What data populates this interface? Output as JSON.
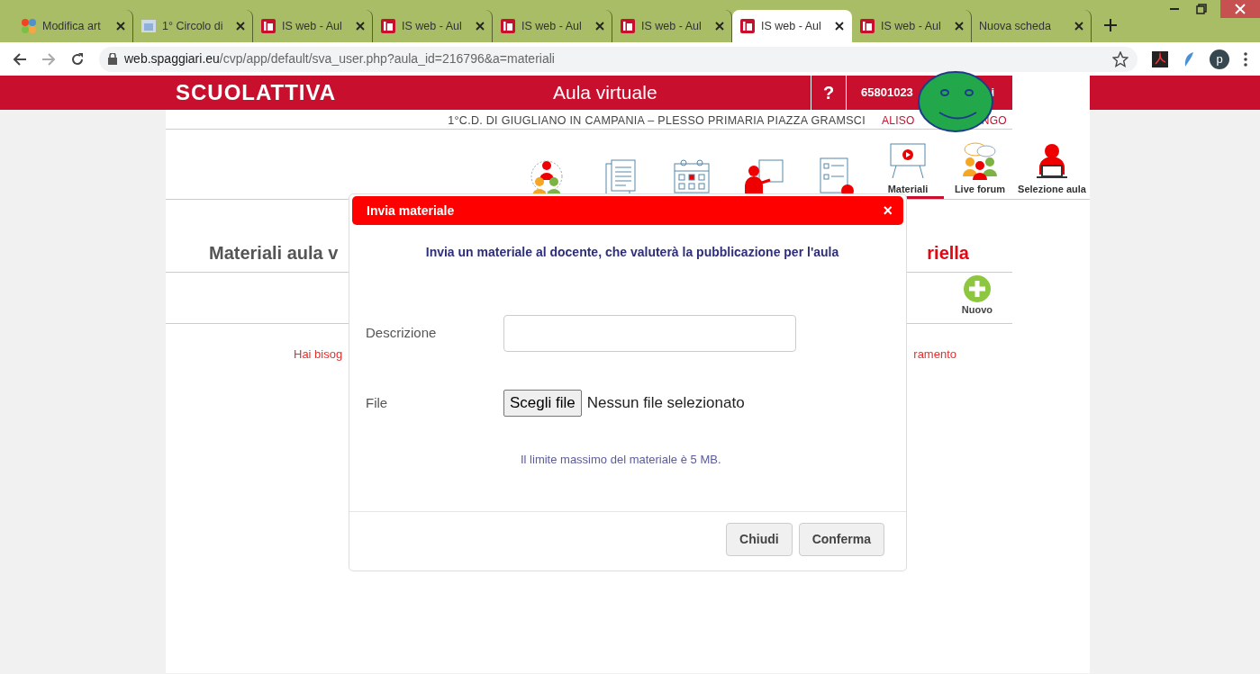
{
  "browser": {
    "tabs": [
      {
        "kind": "cms",
        "title": "Modifica art",
        "selected": false
      },
      {
        "kind": "school",
        "title": "1° Circolo di",
        "selected": false
      },
      {
        "kind": "app",
        "title": "IS web - Aul",
        "selected": false
      },
      {
        "kind": "app",
        "title": "IS web - Aul",
        "selected": false
      },
      {
        "kind": "app",
        "title": "IS web - Aul",
        "selected": false
      },
      {
        "kind": "app",
        "title": "IS web - Aul",
        "selected": false
      },
      {
        "kind": "app",
        "title": "IS web - Aul",
        "selected": true
      },
      {
        "kind": "app",
        "title": "IS web - Aul",
        "selected": false
      },
      {
        "kind": "blank",
        "title": "Nuova scheda",
        "selected": false
      }
    ],
    "address": {
      "host": "web.spaggiari.eu",
      "path": "/cvp/app/default/sva_user.php?aula_id=216796&a=materiali"
    },
    "avatar_letter": "p"
  },
  "header": {
    "logo": "SCUOLATTIVA",
    "title": "Aula virtuale",
    "help": "?",
    "user_code_start": "65801023",
    "user_code_end": "i",
    "school": "1°C.D. DI GIUGLIANO IN CAMPANIA – PLESSO PRIMARIA PIAZZA GRAMSCI",
    "user_name_start": "ALISO",
    "user_name_end": "NGO"
  },
  "nav": [
    {
      "kind": "groups"
    },
    {
      "kind": "project"
    },
    {
      "kind": "planner"
    },
    {
      "kind": "lessons"
    },
    {
      "kind": "test"
    },
    {
      "kind": "materials",
      "label": "Materiali",
      "selected": true
    },
    {
      "kind": "forum",
      "label": "Live forum",
      "selected": false
    },
    {
      "kind": "room",
      "label": "Selezione aula",
      "selected": false
    }
  ],
  "page": {
    "title_start": "Materiali aula v",
    "title_end": "riella",
    "new_button": "Nuovo",
    "help_start": "Hai bisog",
    "help_end": "ramento"
  },
  "modal": {
    "title": "Invia materiale",
    "close": "×",
    "intro": "Invia un materiale al docente, che valuterà la pubblicazione per l'aula",
    "description_label": "Descrizione",
    "file_label": "File",
    "file_button": "Scegli file",
    "file_status": "Nessun file selezionato",
    "limit_note": "Il limite massimo del materiale è 5 MB.",
    "buttons": [
      "Chiudi",
      "Conferma"
    ]
  }
}
